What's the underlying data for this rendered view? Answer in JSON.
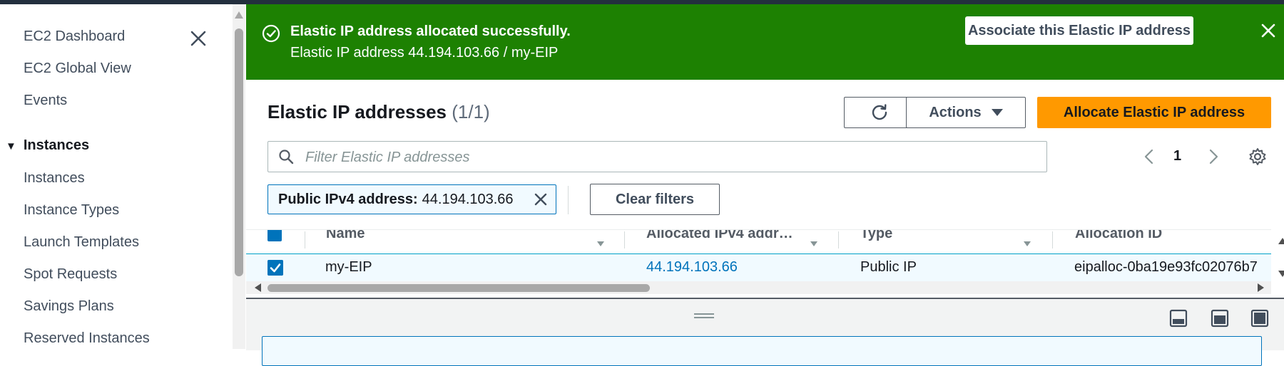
{
  "sidebar": {
    "top_items": [
      "EC2 Dashboard",
      "EC2 Global View",
      "Events"
    ],
    "section": "Instances",
    "section_items": [
      "Instances",
      "Instance Types",
      "Launch Templates",
      "Spot Requests",
      "Savings Plans",
      "Reserved Instances"
    ]
  },
  "flash": {
    "title": "Elastic IP address allocated successfully.",
    "detail": "Elastic IP address 44.194.103.66 / my-EIP",
    "action_label": "Associate this Elastic IP address"
  },
  "header": {
    "title": "Elastic IP addresses",
    "count": "(1/1)",
    "actions_label": "Actions",
    "allocate_label": "Allocate Elastic IP address"
  },
  "search": {
    "placeholder": "Filter Elastic IP addresses"
  },
  "pagination": {
    "current_page": "1"
  },
  "filter_token": {
    "key": "Public IPv4 address:",
    "value": "44.194.103.66"
  },
  "clear_filters_label": "Clear filters",
  "table": {
    "columns": [
      "Name",
      "Allocated IPv4 addr…",
      "Type",
      "Allocation ID"
    ],
    "rows": [
      {
        "name": "my-EIP",
        "ip": "44.194.103.66",
        "type": "Public IP",
        "allocation_id": "eipalloc-0ba19e93fc02076b7",
        "selected": true
      }
    ]
  },
  "colors": {
    "flash_success": "#1d8102",
    "primary": "#ff9900",
    "link": "#0073bb",
    "topbar": "#232f3e"
  }
}
